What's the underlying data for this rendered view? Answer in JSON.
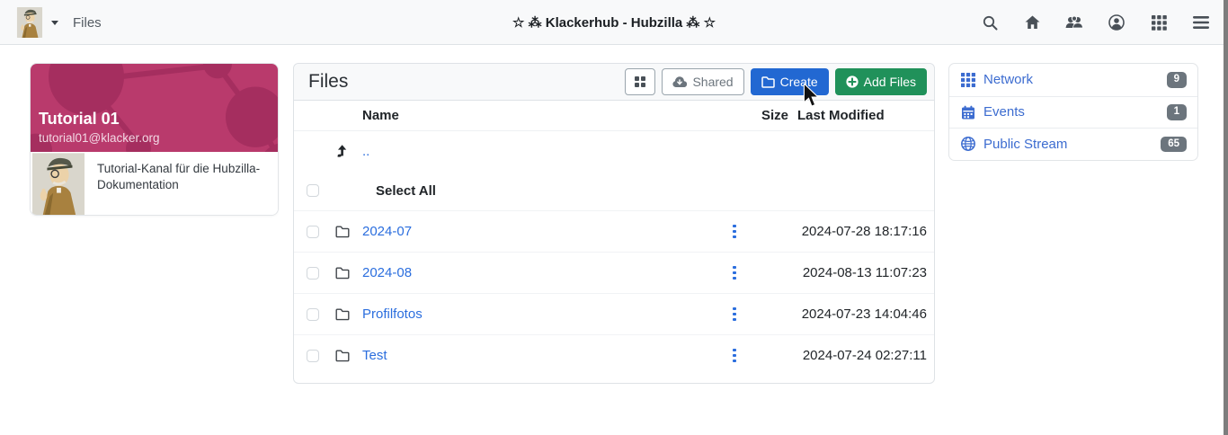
{
  "colors": {
    "navbar_bg": "#f8f9fa",
    "banner_magenta": "#b93a6c",
    "banner_pattern": "#a52e5f",
    "primary_blue": "#2268d2",
    "success_green": "#20915a",
    "file_link_blue": "#2b6ede",
    "sidebar_link_blue": "#3c6cd0",
    "badge_gray": "#6c757d"
  },
  "navbar": {
    "app_label": "Files",
    "site_title": "☆ ⁂ Klackerhub - Hubzilla ⁂ ☆",
    "right_icons": [
      "search-icon",
      "home-icon",
      "group-icon",
      "account-icon",
      "apps-grid-icon",
      "menu-icon"
    ]
  },
  "channel_card": {
    "name": "Tutorial 01",
    "address": "tutorial01@klacker.org",
    "description": "Tutorial-Kanal für die Hubzilla-Dokumentation"
  },
  "files_panel": {
    "title": "Files",
    "buttons": {
      "shared": "Shared",
      "create": "Create",
      "add_files": "Add Files"
    },
    "table": {
      "headers": {
        "name": "Name",
        "size": "Size",
        "last_modified": "Last Modified"
      },
      "parent_link": "..",
      "select_all_label": "Select All",
      "rows": [
        {
          "name": "2024-07",
          "size": "",
          "modified": "2024-07-28 18:17:16"
        },
        {
          "name": "2024-08",
          "size": "",
          "modified": "2024-08-13 11:07:23"
        },
        {
          "name": "Profilfotos",
          "size": "",
          "modified": "2024-07-23 14:04:46"
        },
        {
          "name": "Test",
          "size": "",
          "modified": "2024-07-24 02:27:11"
        }
      ]
    }
  },
  "right_sidebar": {
    "items": [
      {
        "label": "Network",
        "count": "9",
        "icon": "grid-icon"
      },
      {
        "label": "Events",
        "count": "1",
        "icon": "calendar-icon"
      },
      {
        "label": "Public Stream",
        "count": "65",
        "icon": "globe-icon"
      }
    ]
  }
}
